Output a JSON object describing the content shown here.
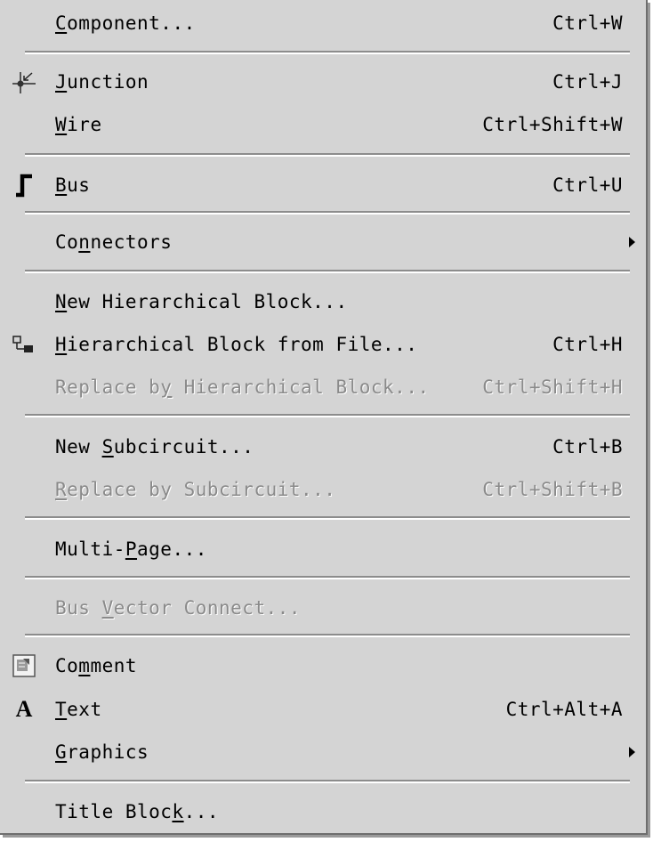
{
  "menu": {
    "items": [
      {
        "label_pre": "",
        "mnemonic": "C",
        "label_post": "omponent...",
        "shortcut": "Ctrl+W"
      },
      {
        "label_pre": "",
        "mnemonic": "J",
        "label_post": "unction",
        "shortcut": "Ctrl+J",
        "icon": "junction-icon"
      },
      {
        "label_pre": "",
        "mnemonic": "W",
        "label_post": "ire",
        "shortcut": "Ctrl+Shift+W"
      },
      {
        "label_pre": "",
        "mnemonic": "B",
        "label_post": "us",
        "shortcut": "Ctrl+U",
        "icon": "bus-icon"
      },
      {
        "label_pre": "Co",
        "mnemonic": "n",
        "label_post": "nectors",
        "shortcut": "",
        "submenu": true
      },
      {
        "label_pre": "",
        "mnemonic": "N",
        "label_post": "ew Hierarchical Block...",
        "shortcut": ""
      },
      {
        "label_pre": "",
        "mnemonic": "H",
        "label_post": "ierarchical Block from File...",
        "shortcut": "Ctrl+H",
        "icon": "hierarchical-block-icon"
      },
      {
        "label_pre": "Replace b",
        "mnemonic": "y",
        "label_post": " Hierarchical Block...",
        "shortcut": "Ctrl+Shift+H",
        "disabled": true
      },
      {
        "label_pre": "New ",
        "mnemonic": "S",
        "label_post": "ubcircuit...",
        "shortcut": "Ctrl+B"
      },
      {
        "label_pre": "",
        "mnemonic": "R",
        "label_post": "eplace by Subcircuit...",
        "shortcut": "Ctrl+Shift+B",
        "disabled": true
      },
      {
        "label_pre": "Multi-",
        "mnemonic": "P",
        "label_post": "age...",
        "shortcut": ""
      },
      {
        "label_pre": "Bus ",
        "mnemonic": "V",
        "label_post": "ector Connect...",
        "shortcut": "",
        "disabled": true
      },
      {
        "label_pre": "Co",
        "mnemonic": "m",
        "label_post": "ment",
        "shortcut": "",
        "icon": "comment-icon"
      },
      {
        "label_pre": "",
        "mnemonic": "T",
        "label_post": "ext",
        "shortcut": "Ctrl+Alt+A",
        "icon": "text-icon"
      },
      {
        "label_pre": "",
        "mnemonic": "G",
        "label_post": "raphics",
        "shortcut": "",
        "submenu": true
      },
      {
        "label_pre": "Title Bloc",
        "mnemonic": "k",
        "label_post": "...",
        "shortcut": ""
      }
    ]
  }
}
